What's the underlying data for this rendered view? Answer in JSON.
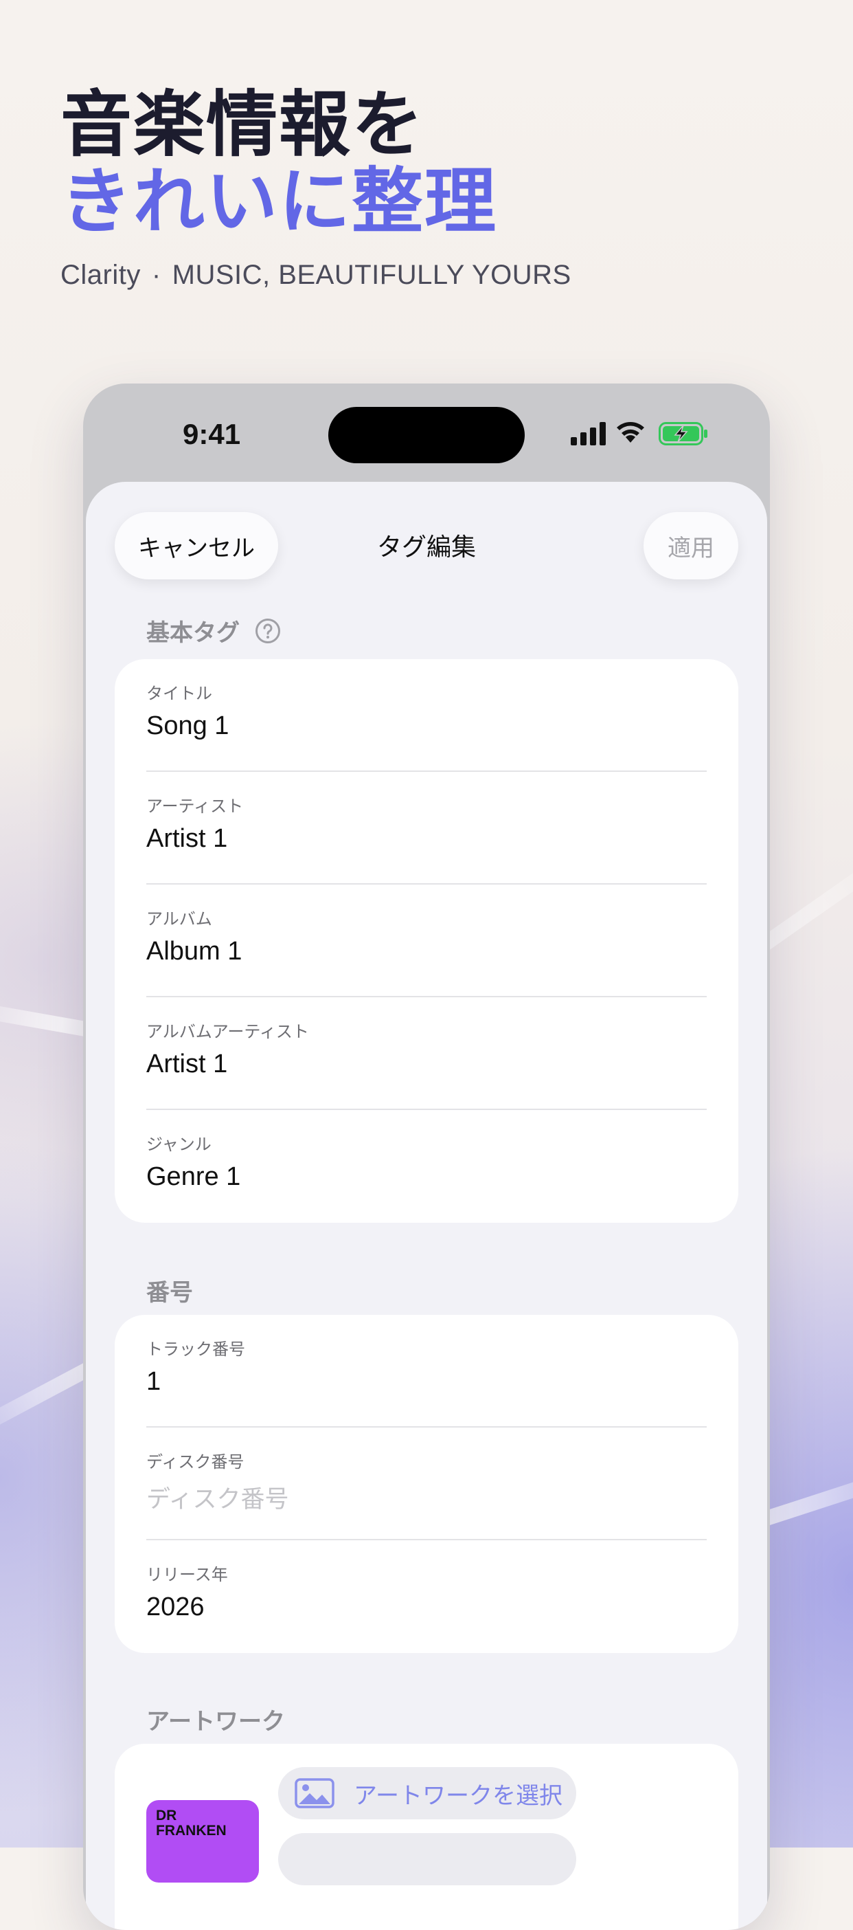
{
  "hero": {
    "line1": "音楽情報を",
    "line2": "きれいに整理",
    "app_name": "Clarity",
    "separator": "·",
    "tagline": "MUSIC, BEAUTIFULLY YOURS"
  },
  "status_bar": {
    "time": "9:41"
  },
  "nav": {
    "cancel_label": "キャンセル",
    "title": "タグ編集",
    "apply_label": "適用"
  },
  "basic_tags": {
    "header": "基本タグ",
    "fields": [
      {
        "label": "タイトル",
        "value": "Song 1"
      },
      {
        "label": "アーティスト",
        "value": "Artist 1"
      },
      {
        "label": "アルバム",
        "value": "Album 1"
      },
      {
        "label": "アルバムアーティスト",
        "value": "Artist 1"
      },
      {
        "label": "ジャンル",
        "value": "Genre 1"
      }
    ]
  },
  "numbers": {
    "header": "番号",
    "track": {
      "label": "トラック番号",
      "value": "1"
    },
    "disc": {
      "label": "ディスク番号",
      "placeholder": "ディスク番号"
    },
    "year": {
      "label": "リリース年",
      "value": "2026"
    }
  },
  "artwork": {
    "header": "アートワーク",
    "thumb_text_1": "DR",
    "thumb_text_2": "FRANKEN",
    "select_label": "アートワークを選択"
  },
  "colors": {
    "accent": "#6267e6",
    "dark": "#1c1c2e",
    "battery": "#34c759"
  }
}
